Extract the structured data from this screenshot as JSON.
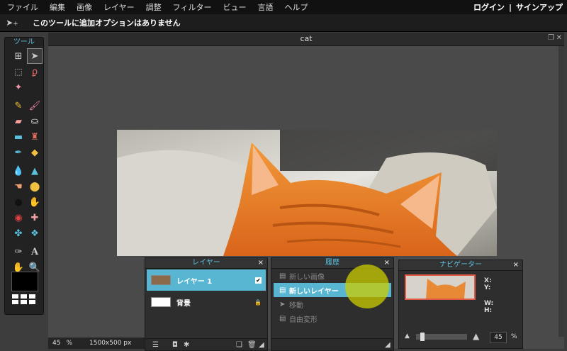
{
  "menu": [
    "ファイル",
    "編集",
    "画像",
    "レイヤー",
    "調整",
    "フィルター",
    "ビュー",
    "言語",
    "ヘルプ"
  ],
  "auth": {
    "login": "ログイン",
    "separator": "|",
    "signup": "サインアップ"
  },
  "options_bar": {
    "message": "このツールに追加オプションはありません",
    "tool_icon": "move-icon"
  },
  "toolbox": {
    "title": "ツール"
  },
  "document": {
    "title": "cat",
    "zoom": "45",
    "zoom_unit": "%",
    "size": "1500x500 px"
  },
  "layers_panel": {
    "title": "レイヤー",
    "close": "×",
    "layers": [
      {
        "name": "レイヤー 1",
        "selected": true,
        "visible": true
      },
      {
        "name": "背景",
        "selected": false,
        "locked": true
      }
    ]
  },
  "history_panel": {
    "title": "履歴",
    "close": "×",
    "items": [
      {
        "label": "新しい画像",
        "selected": false
      },
      {
        "label": "新しいレイヤー",
        "selected": true
      },
      {
        "label": "移動",
        "selected": false
      },
      {
        "label": "自由変形",
        "selected": false
      }
    ]
  },
  "navigator_panel": {
    "title": "ナビゲーター",
    "close": "×",
    "x_label": "X:",
    "y_label": "Y:",
    "w_label": "W:",
    "h_label": "H:",
    "zoom": "45",
    "zoom_unit": "%"
  },
  "colors": {
    "accent": "#59b6d3",
    "highlight": "#cccc00",
    "nav_frame": "#e05a47"
  }
}
